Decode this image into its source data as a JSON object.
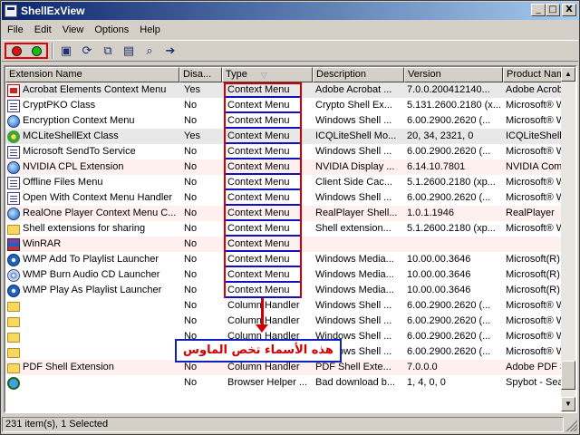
{
  "window": {
    "title": "ShellExView",
    "minimize": "_",
    "maximize": "□",
    "close": "X"
  },
  "menu": [
    "File",
    "Edit",
    "View",
    "Options",
    "Help"
  ],
  "toolbar": {
    "colors": {
      "record_outline": "#e00000",
      "disable_dot": "#e01010",
      "enable_dot": "#10c010"
    }
  },
  "columns": [
    "Extension Name",
    "Disa...",
    "Type",
    "Description",
    "Version",
    "Product Nam"
  ],
  "rows": [
    {
      "icon": "pdf-icon",
      "name": "Acrobat Elements Context Menu",
      "disabled": "Yes",
      "type": "Context Menu",
      "desc": "Adobe Acrobat ...",
      "ver": "7.0.0.200412140...",
      "prod": "Adobe Acrob",
      "style": "sel"
    },
    {
      "icon": "document-icon",
      "name": "CryptPKO Class",
      "disabled": "No",
      "type": "Context Menu",
      "desc": "Crypto Shell Ex...",
      "ver": "5.131.2600.2180 (x...",
      "prod": "Microsoft® W",
      "style": ""
    },
    {
      "icon": "globe-icon",
      "name": "Encryption Context Menu",
      "disabled": "No",
      "type": "Context Menu",
      "desc": "Windows Shell ...",
      "ver": "6.00.2900.2620 (...",
      "prod": "Microsoft® W",
      "style": ""
    },
    {
      "icon": "flower-icon",
      "name": "MCLiteShellExt Class",
      "disabled": "Yes",
      "type": "Context Menu",
      "desc": "ICQLiteShell Mo...",
      "ver": "20, 34, 2321, 0",
      "prod": "ICQLiteShell",
      "style": "sel"
    },
    {
      "icon": "document-icon",
      "name": "Microsoft SendTo Service",
      "disabled": "No",
      "type": "Context Menu",
      "desc": "Windows Shell ...",
      "ver": "6.00.2900.2620 (...",
      "prod": "Microsoft® W",
      "style": ""
    },
    {
      "icon": "globe-icon",
      "name": "NVIDIA CPL Extension",
      "disabled": "No",
      "type": "Context Menu",
      "desc": "NVIDIA Display ...",
      "ver": "6.14.10.7801",
      "prod": "NVIDIA Comp",
      "style": "alt"
    },
    {
      "icon": "document-icon",
      "name": "Offline Files Menu",
      "disabled": "No",
      "type": "Context Menu",
      "desc": "Client Side Cac...",
      "ver": "5.1.2600.2180 (xp...",
      "prod": "Microsoft® W",
      "style": ""
    },
    {
      "icon": "document-icon",
      "name": "Open With Context Menu Handler",
      "disabled": "No",
      "type": "Context Menu",
      "desc": "Windows Shell ...",
      "ver": "6.00.2900.2620 (...",
      "prod": "Microsoft® W",
      "style": ""
    },
    {
      "icon": "globe-icon",
      "name": "RealOne Player Context Menu C...",
      "disabled": "No",
      "type": "Context Menu",
      "desc": "RealPlayer Shell...",
      "ver": "1.0.1.1946",
      "prod": "RealPlayer",
      "style": "alt"
    },
    {
      "icon": "folder-icon",
      "name": "Shell extensions for sharing",
      "disabled": "No",
      "type": "Context Menu",
      "desc": "Shell extension...",
      "ver": "5.1.2600.2180 (xp...",
      "prod": "Microsoft® W",
      "style": ""
    },
    {
      "icon": "winrar-icon",
      "name": "WinRAR",
      "disabled": "No",
      "type": "Context Menu",
      "desc": "",
      "ver": "",
      "prod": "",
      "style": "alt"
    },
    {
      "icon": "media-player-icon",
      "name": "WMP Add To Playlist Launcher",
      "disabled": "No",
      "type": "Context Menu",
      "desc": "Windows Media...",
      "ver": "10.00.00.3646",
      "prod": "Microsoft(R)",
      "style": ""
    },
    {
      "icon": "cd-icon",
      "name": "WMP Burn Audio CD Launcher",
      "disabled": "No",
      "type": "Context Menu",
      "desc": "Windows Media...",
      "ver": "10.00.00.3646",
      "prod": "Microsoft(R)",
      "style": ""
    },
    {
      "icon": "media-player-icon",
      "name": "WMP Play As Playlist Launcher",
      "disabled": "No",
      "type": "Context Menu",
      "desc": "Windows Media...",
      "ver": "10.00.00.3646",
      "prod": "Microsoft(R)",
      "style": ""
    },
    {
      "icon": "folder-icon",
      "name": "",
      "disabled": "No",
      "type": "Column Handler",
      "desc": "Windows Shell ...",
      "ver": "6.00.2900.2620 (...",
      "prod": "Microsoft® W",
      "style": ""
    },
    {
      "icon": "folder-icon",
      "name": "",
      "disabled": "No",
      "type": "Column Handler",
      "desc": "Windows Shell ...",
      "ver": "6.00.2900.2620 (...",
      "prod": "Microsoft® W",
      "style": ""
    },
    {
      "icon": "folder-icon",
      "name": "",
      "disabled": "No",
      "type": "Column Handler",
      "desc": "Windows Shell ...",
      "ver": "6.00.2900.2620 (...",
      "prod": "Microsoft® W",
      "style": ""
    },
    {
      "icon": "folder-icon",
      "name": "",
      "disabled": "No",
      "type": "Column Handler",
      "desc": "Windows Shell ...",
      "ver": "6.00.2900.2620 (...",
      "prod": "Microsoft® W",
      "style": ""
    },
    {
      "icon": "folder-icon",
      "name": "PDF Shell Extension",
      "disabled": "No",
      "type": "Column Handler",
      "desc": "PDF Shell Exte...",
      "ver": "7.0.0.0",
      "prod": "Adobe PDF S",
      "style": "alt"
    },
    {
      "icon": "search-icon",
      "name": "",
      "disabled": "No",
      "type": "Browser Helper ...",
      "desc": "Bad download b...",
      "ver": "1, 4, 0, 0",
      "prod": "Spybot - Sea",
      "style": ""
    }
  ],
  "annotation": {
    "text": "هذه الأسماء تخص الماوس",
    "colors": {
      "box": "#d00000",
      "underline": "#1010c0"
    }
  },
  "status": {
    "text": "231 item(s), 1 Selected"
  }
}
